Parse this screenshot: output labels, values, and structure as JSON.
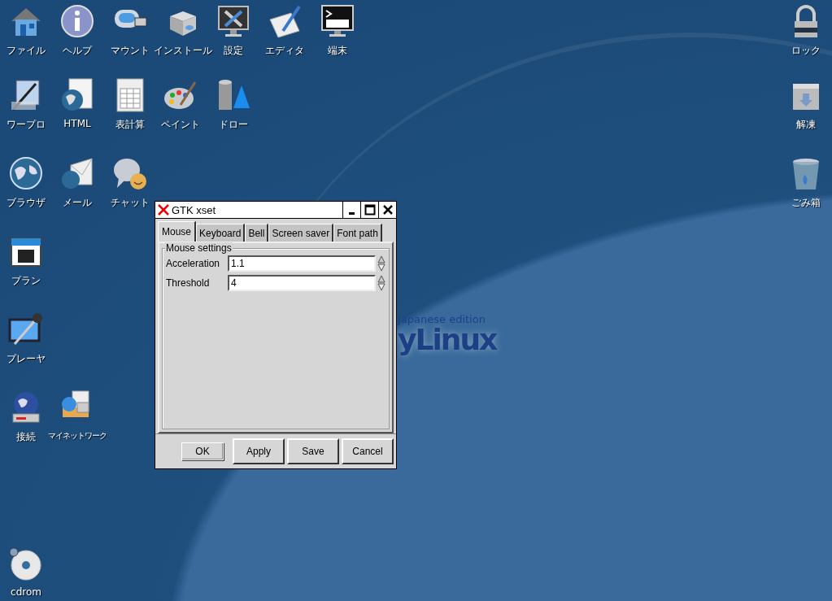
{
  "desktop_icons": [
    {
      "label": "ファイル"
    },
    {
      "label": "ヘルプ"
    },
    {
      "label": "マウント"
    },
    {
      "label": "インストール"
    },
    {
      "label": "設定"
    },
    {
      "label": "エディタ"
    },
    {
      "label": "端末"
    },
    {
      "label": "ワープロ"
    },
    {
      "label": "HTML"
    },
    {
      "label": "表計算"
    },
    {
      "label": "ペイント"
    },
    {
      "label": "ドロー"
    },
    {
      "label": "ブラウザ"
    },
    {
      "label": "メール"
    },
    {
      "label": "チャット"
    },
    {
      "label": "プラン"
    },
    {
      "label": "プレーヤ"
    },
    {
      "label": "接続"
    },
    {
      "label": "マイネットワーク"
    },
    {
      "label": "cdrom"
    },
    {
      "label": "ロック"
    },
    {
      "label": "解凍"
    },
    {
      "label": "ごみ箱"
    }
  ],
  "wallpaper_logo": {
    "subtitle": "Japanese edition",
    "name": "yLinux"
  },
  "window": {
    "title": "GTK xset",
    "tabs": [
      {
        "label": "Mouse",
        "selected": true
      },
      {
        "label": "Keyboard",
        "selected": false
      },
      {
        "label": "Bell",
        "selected": false
      },
      {
        "label": "Screen saver",
        "selected": false
      },
      {
        "label": "Font path",
        "selected": false
      }
    ],
    "group": {
      "title": "Mouse settings",
      "fields": [
        {
          "label": "Acceleration",
          "value": "1.1"
        },
        {
          "label": "Threshold",
          "value": "4"
        }
      ]
    },
    "buttons": [
      {
        "label": "OK",
        "default": true
      },
      {
        "label": "Apply",
        "default": false
      },
      {
        "label": "Save",
        "default": false
      },
      {
        "label": "Cancel",
        "default": false
      }
    ]
  }
}
